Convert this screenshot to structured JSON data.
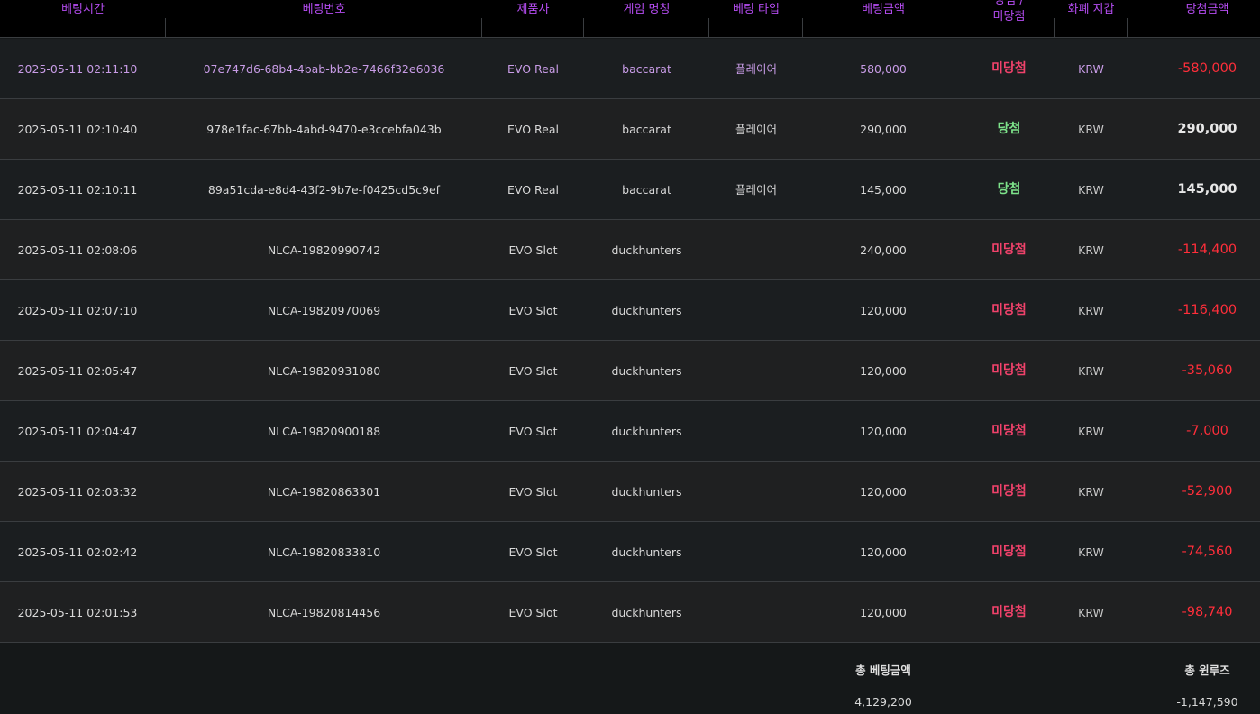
{
  "headers": {
    "bet_time": "베팅시간",
    "bet_id": "베팅번호",
    "provider": "제품사",
    "game_name": "게임 명칭",
    "bet_type": "베팅 타입",
    "bet_amount": "베팅금액",
    "result_line1": "당첨 /",
    "result_line2": "미당첨",
    "currency": "화폐 지갑",
    "win_amount": "당첨금액"
  },
  "rows": [
    {
      "time": "2025-05-11 02:11:10",
      "id": "07e747d6-68b4-4bab-bb2e-7466f32e6036",
      "provider": "EVO Real",
      "game": "baccarat",
      "type": "플레이어",
      "amount": "580,000",
      "result": "미당첨",
      "result_kind": "lose",
      "currency": "KRW",
      "win": "-580,000",
      "win_kind": "neg"
    },
    {
      "time": "2025-05-11 02:10:40",
      "id": "978e1fac-67bb-4abd-9470-e3ccebfa043b",
      "provider": "EVO Real",
      "game": "baccarat",
      "type": "플레이어",
      "amount": "290,000",
      "result": "당첨",
      "result_kind": "win",
      "currency": "KRW",
      "win": "290,000",
      "win_kind": "pos"
    },
    {
      "time": "2025-05-11 02:10:11",
      "id": "89a51cda-e8d4-43f2-9b7e-f0425cd5c9ef",
      "provider": "EVO Real",
      "game": "baccarat",
      "type": "플레이어",
      "amount": "145,000",
      "result": "당첨",
      "result_kind": "win",
      "currency": "KRW",
      "win": "145,000",
      "win_kind": "pos"
    },
    {
      "time": "2025-05-11 02:08:06",
      "id": "NLCA-19820990742",
      "provider": "EVO Slot",
      "game": "duckhunters",
      "type": "",
      "amount": "240,000",
      "result": "미당첨",
      "result_kind": "lose",
      "currency": "KRW",
      "win": "-114,400",
      "win_kind": "neg"
    },
    {
      "time": "2025-05-11 02:07:10",
      "id": "NLCA-19820970069",
      "provider": "EVO Slot",
      "game": "duckhunters",
      "type": "",
      "amount": "120,000",
      "result": "미당첨",
      "result_kind": "lose",
      "currency": "KRW",
      "win": "-116,400",
      "win_kind": "neg"
    },
    {
      "time": "2025-05-11 02:05:47",
      "id": "NLCA-19820931080",
      "provider": "EVO Slot",
      "game": "duckhunters",
      "type": "",
      "amount": "120,000",
      "result": "미당첨",
      "result_kind": "lose",
      "currency": "KRW",
      "win": "-35,060",
      "win_kind": "neg"
    },
    {
      "time": "2025-05-11 02:04:47",
      "id": "NLCA-19820900188",
      "provider": "EVO Slot",
      "game": "duckhunters",
      "type": "",
      "amount": "120,000",
      "result": "미당첨",
      "result_kind": "lose",
      "currency": "KRW",
      "win": "-7,000",
      "win_kind": "neg"
    },
    {
      "time": "2025-05-11 02:03:32",
      "id": "NLCA-19820863301",
      "provider": "EVO Slot",
      "game": "duckhunters",
      "type": "",
      "amount": "120,000",
      "result": "미당첨",
      "result_kind": "lose",
      "currency": "KRW",
      "win": "-52,900",
      "win_kind": "neg"
    },
    {
      "time": "2025-05-11 02:02:42",
      "id": "NLCA-19820833810",
      "provider": "EVO Slot",
      "game": "duckhunters",
      "type": "",
      "amount": "120,000",
      "result": "미당첨",
      "result_kind": "lose",
      "currency": "KRW",
      "win": "-74,560",
      "win_kind": "neg"
    },
    {
      "time": "2025-05-11 02:01:53",
      "id": "NLCA-19820814456",
      "provider": "EVO Slot",
      "game": "duckhunters",
      "type": "",
      "amount": "120,000",
      "result": "미당첨",
      "result_kind": "lose",
      "currency": "KRW",
      "win": "-98,740",
      "win_kind": "neg"
    }
  ],
  "summary": {
    "total_bet_label": "총 베팅금액",
    "total_bet_value": "4,129,200",
    "total_winloss_label": "총 윈루즈",
    "total_winloss_value": "-1,147,590"
  },
  "colors": {
    "header_text": "#b44cf0",
    "lose": "#f1426b",
    "win": "#7de38a",
    "negative_amount": "#ff2e3a"
  }
}
